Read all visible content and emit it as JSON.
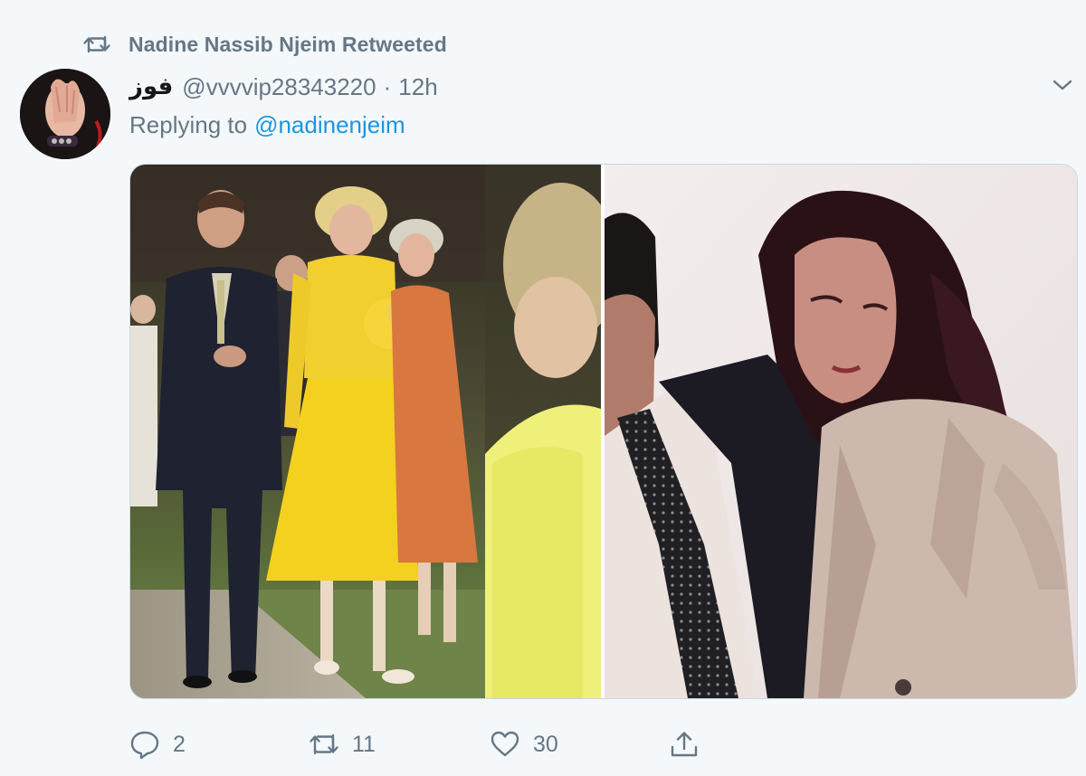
{
  "retweet_banner": {
    "icon": "retweet-icon",
    "text": "Nadine Nassib Njeim Retweeted"
  },
  "author": {
    "display_name": "فوز",
    "handle": "@vvvvip28343220",
    "separator": "·",
    "time": "12h"
  },
  "reply": {
    "label": "Replying to",
    "mention": "@nadinenjeim"
  },
  "menu": {
    "icon": "chevron-down-icon"
  },
  "media": {
    "photo_count": 2
  },
  "actions": {
    "reply": {
      "icon": "reply-icon",
      "count": "2"
    },
    "retweet": {
      "icon": "retweet-icon",
      "count": "11"
    },
    "like": {
      "icon": "heart-icon",
      "count": "30"
    },
    "share": {
      "icon": "share-icon"
    }
  },
  "colors": {
    "background": "#f5f8fa",
    "secondary_text": "#657786",
    "link": "#1b95e0",
    "icon": "#657786"
  }
}
